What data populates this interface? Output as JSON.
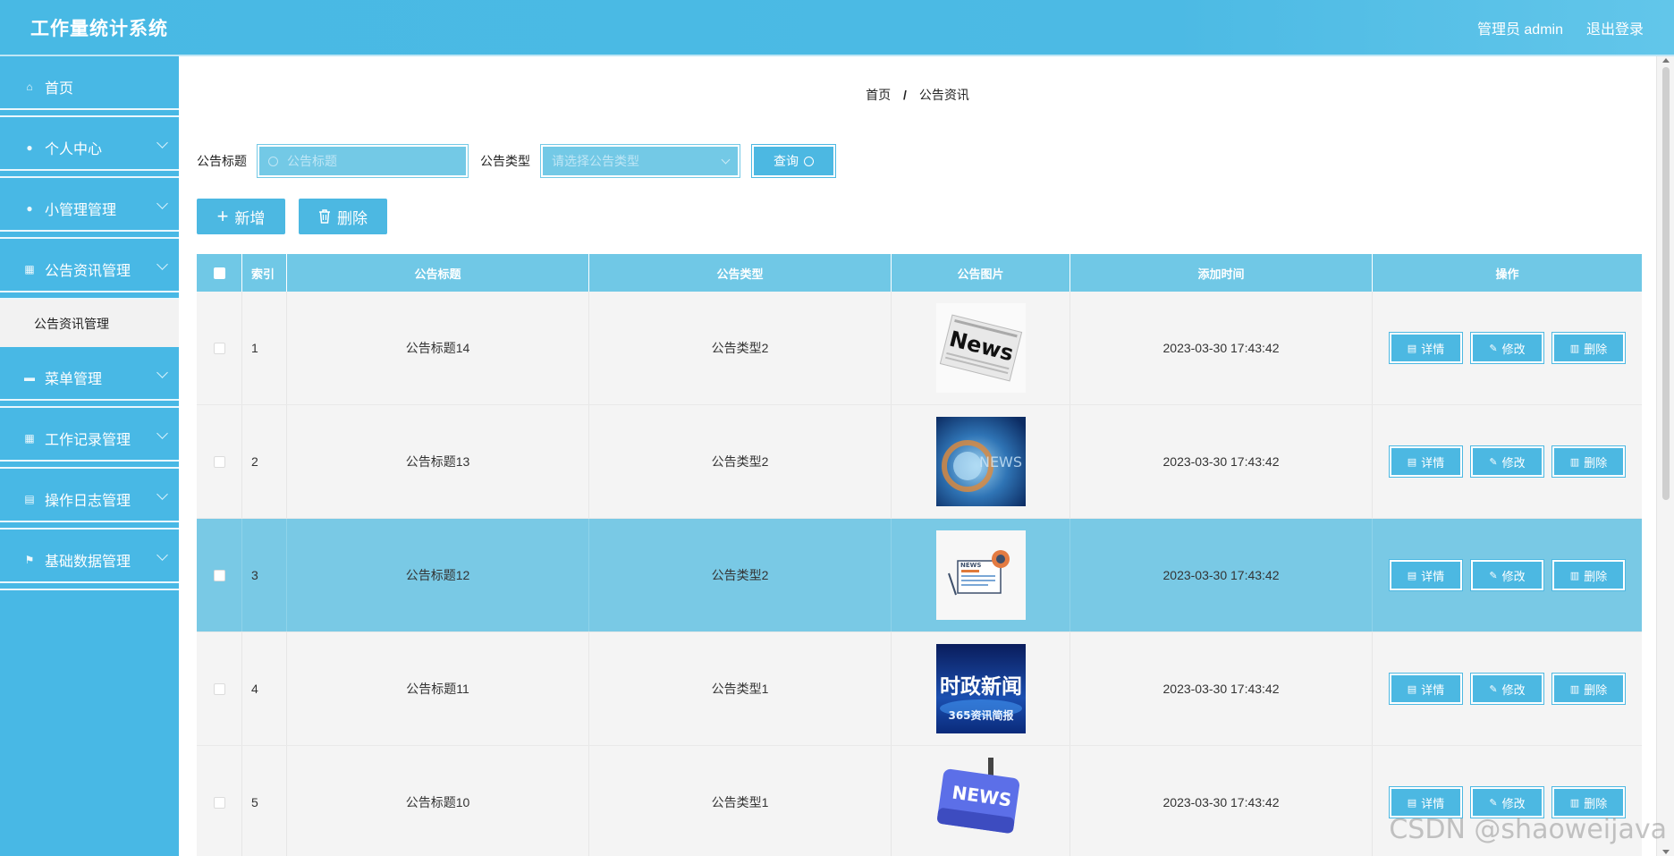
{
  "header": {
    "title": "工作量统计系统",
    "user": "管理员 admin",
    "logout": "退出登录"
  },
  "sidebar": {
    "items": [
      {
        "label": "首页",
        "icon": "home-icon",
        "expandable": false
      },
      {
        "label": "个人中心",
        "icon": "user-icon",
        "expandable": true
      },
      {
        "label": "小管理管理",
        "icon": "user-icon",
        "expandable": true
      },
      {
        "label": "公告资讯管理",
        "icon": "grid-icon",
        "expandable": true
      },
      {
        "label": "菜单管理",
        "icon": "monitor-icon",
        "expandable": true
      },
      {
        "label": "工作记录管理",
        "icon": "grid-icon",
        "expandable": true
      },
      {
        "label": "操作日志管理",
        "icon": "clipboard-icon",
        "expandable": true
      },
      {
        "label": "基础数据管理",
        "icon": "flag-icon",
        "expandable": true
      }
    ],
    "submenu": {
      "label": "公告资讯管理"
    }
  },
  "breadcrumb": {
    "home": "首页",
    "separator": "/",
    "current": "公告资讯"
  },
  "search": {
    "title_label": "公告标题",
    "title_placeholder": "公告标题",
    "type_label": "公告类型",
    "type_placeholder": "请选择公告类型",
    "query_label": "查询"
  },
  "actions": {
    "add_label": "新增",
    "delete_label": "删除"
  },
  "table": {
    "headers": [
      "索引",
      "公告标题",
      "公告类型",
      "公告图片",
      "添加时间",
      "操作"
    ],
    "op_labels": {
      "detail": "详情",
      "edit": "修改",
      "delete": "删除"
    },
    "rows": [
      {
        "index": "1",
        "title": "公告标题14",
        "type": "公告类型2",
        "time": "2023-03-30 17:43:42"
      },
      {
        "index": "2",
        "title": "公告标题13",
        "type": "公告类型2",
        "time": "2023-03-30 17:43:42"
      },
      {
        "index": "3",
        "title": "公告标题12",
        "type": "公告类型2",
        "time": "2023-03-30 17:43:42",
        "highlighted": true
      },
      {
        "index": "4",
        "title": "公告标题11",
        "type": "公告类型1",
        "time": "2023-03-30 17:43:42"
      },
      {
        "index": "5",
        "title": "公告标题10",
        "type": "公告类型1",
        "time": "2023-03-30 17:43:42"
      }
    ]
  },
  "images": {
    "img1_text": "News",
    "img2_text": "NEWS",
    "img3_text": "NEWS",
    "img4_line1": "时政新闻",
    "img4_line2": "365资讯简报",
    "img5_text": "NEWS"
  },
  "watermark": "CSDN @shaoweijava",
  "colors": {
    "primary": "#48b8e5",
    "row_highlight": "#79c9e5",
    "header_row": "#70c8e6"
  }
}
